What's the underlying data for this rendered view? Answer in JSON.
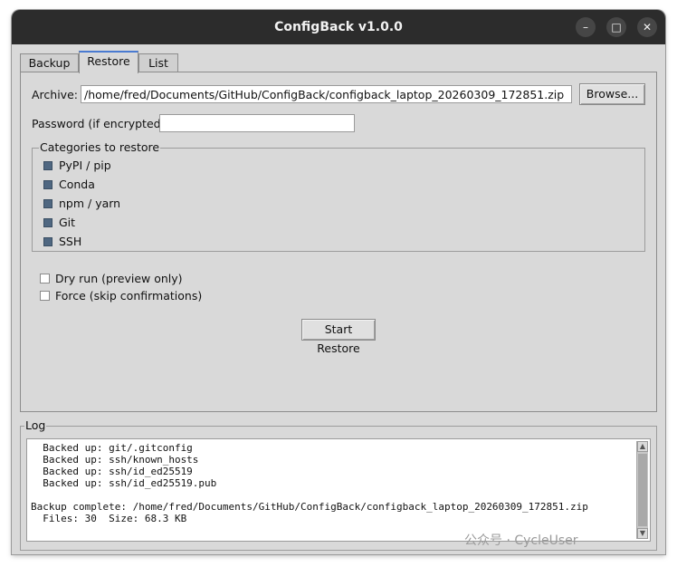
{
  "window": {
    "title": "ConfigBack v1.0.0",
    "controls": {
      "minimize": "–",
      "maximize": "□",
      "close": "✕"
    }
  },
  "tabs": [
    {
      "label": "Backup"
    },
    {
      "label": "Restore"
    },
    {
      "label": "List"
    }
  ],
  "restore": {
    "archive_label": "Archive:",
    "archive_value": "/home/fred/Documents/GitHub/ConfigBack/configback_laptop_20260309_172851.zip",
    "browse_label": "Browse...",
    "password_label": "Password (if encrypted):",
    "password_value": "",
    "categories_title": "Categories to restore",
    "categories": [
      {
        "label": "PyPI / pip",
        "checked": true
      },
      {
        "label": "Conda",
        "checked": true
      },
      {
        "label": "npm / yarn",
        "checked": true
      },
      {
        "label": "Git",
        "checked": true
      },
      {
        "label": "SSH",
        "checked": true
      }
    ],
    "options": [
      {
        "label": "Dry run (preview only)",
        "checked": false
      },
      {
        "label": "Force (skip confirmations)",
        "checked": false
      }
    ],
    "start_label": "Start Restore"
  },
  "log": {
    "title": "Log",
    "lines": [
      "  Backed up: git/.gitconfig",
      "  Backed up: ssh/known_hosts",
      "  Backed up: ssh/id_ed25519",
      "  Backed up: ssh/id_ed25519.pub",
      "",
      "Backup complete: /home/fred/Documents/GitHub/ConfigBack/configback_laptop_20260309_172851.zip",
      "  Files: 30  Size: 68.3 KB"
    ]
  },
  "watermark": "公众号 · CycleUser",
  "colors": {
    "titlebar": "#2c2c2c",
    "window_bg": "#d9d9d9",
    "checkbox_fill": "#4f6781"
  }
}
